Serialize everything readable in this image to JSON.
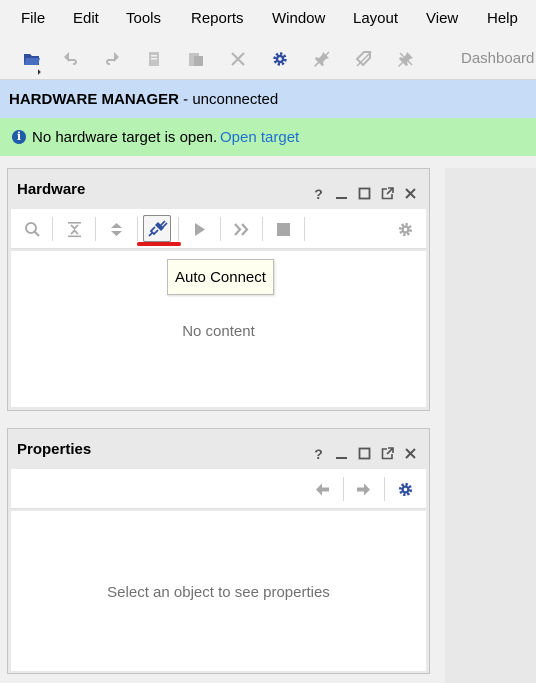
{
  "menu": [
    "File",
    "Edit",
    "Tools",
    "Reports",
    "Window",
    "Layout",
    "View",
    "Help"
  ],
  "toolbar": {
    "dashboard_label": "Dashboard",
    "icons": [
      "open-folder-icon",
      "undo-icon",
      "redo-icon",
      "copy-icon",
      "paste-icon",
      "delete-icon",
      "settings-icon",
      "pin-icon",
      "tag-icon",
      "unpin-icon"
    ]
  },
  "hardware_manager": {
    "title": "HARDWARE MANAGER",
    "status": " - unconnected"
  },
  "notice": {
    "message": "No hardware target is open.",
    "link": "Open target"
  },
  "hardware_panel": {
    "title": "Hardware",
    "empty_text": "No content",
    "tooltip": "Auto Connect",
    "toolbar_icons": [
      "search-icon",
      "collapse-all-icon",
      "expand-all-icon",
      "auto-connect-icon",
      "run-icon",
      "run-all-icon",
      "stop-icon",
      "settings-icon"
    ]
  },
  "properties_panel": {
    "title": "Properties",
    "empty_text": "Select an object to see properties",
    "toolbar_icons": [
      "back-arrow-icon",
      "forward-arrow-icon",
      "settings-icon"
    ]
  },
  "panel_controls": [
    "?",
    "minimize",
    "maximize",
    "float",
    "close"
  ],
  "colors": {
    "hm_banner_bg": "#c6dcf7",
    "notice_bg": "#b6f3b2",
    "link": "#1f6fd1",
    "icon_blue": "#2f4f9e",
    "highlight_underline": "#e01919"
  }
}
